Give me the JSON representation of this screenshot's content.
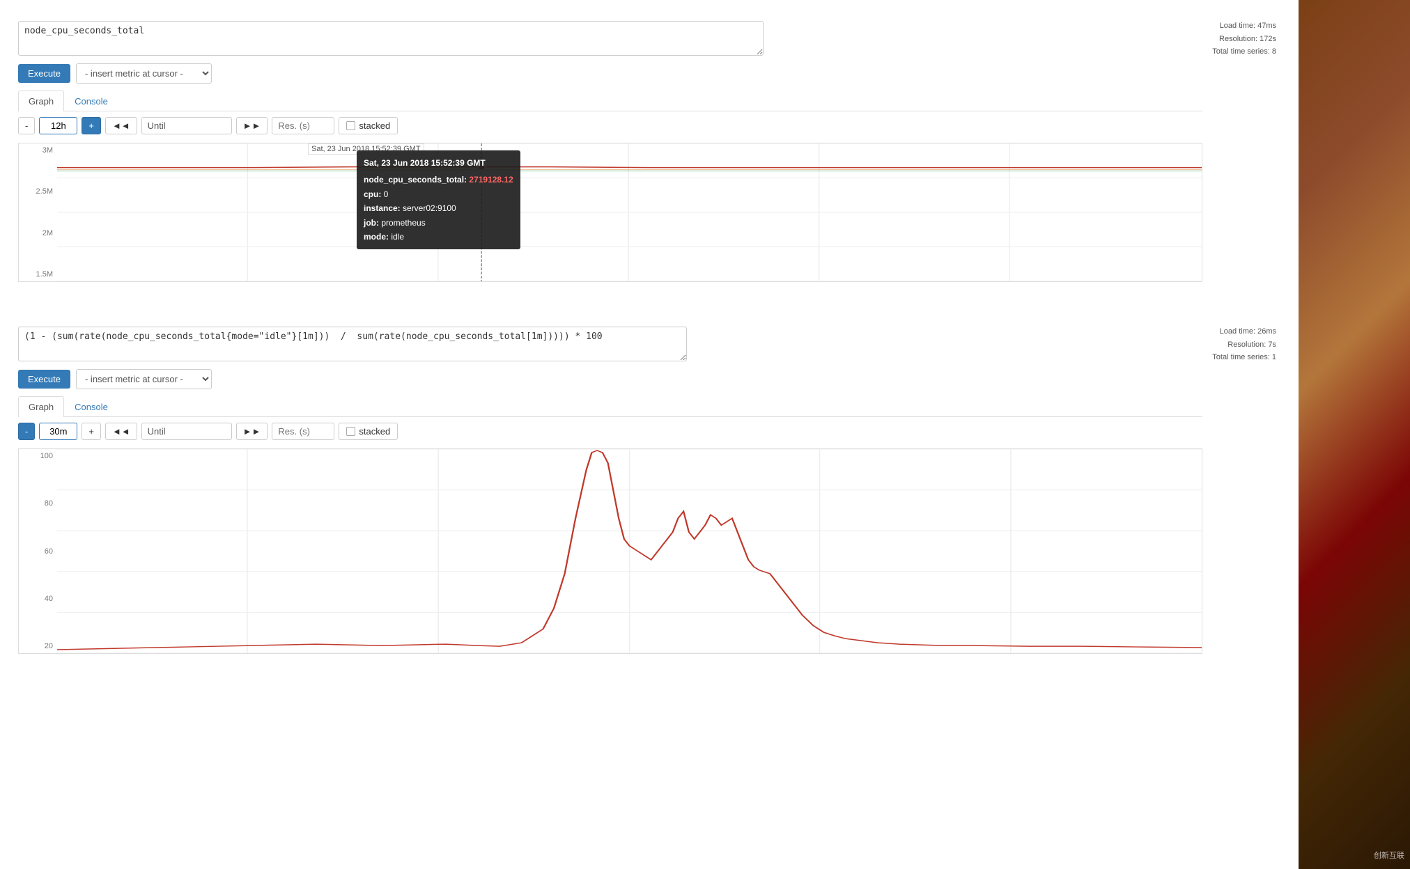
{
  "panel1": {
    "query": "node_cpu_seconds_total",
    "execute_label": "Execute",
    "insert_metric_placeholder": "- insert metric at cursor -",
    "meta": {
      "load_time": "Load time: 47ms",
      "resolution": "Resolution: 172s",
      "total_series": "Total time series: 8"
    },
    "tabs": [
      {
        "label": "Graph",
        "active": true
      },
      {
        "label": "Console",
        "active": false
      }
    ],
    "graph_controls": {
      "minus": "-",
      "time_range": "12h",
      "plus": "+",
      "back": "◄◄",
      "until": "Until",
      "forward": "►►",
      "res_placeholder": "Res. (s)",
      "stacked": "stacked"
    },
    "y_axis": [
      "3M",
      "2.5M",
      "2M",
      "1.5M"
    ],
    "tooltip": {
      "time": "Sat, 23 Jun 2018 15:52:39 GMT",
      "metric": "node_cpu_seconds_total:",
      "value": "2719128.12",
      "cpu": "0",
      "instance": "server02:9100",
      "job": "prometheus",
      "mode": "idle"
    }
  },
  "panel2": {
    "query": "(1 - (sum(rate(node_cpu_seconds_total{mode=\"idle\"}[1m]))  /  sum(rate(node_cpu_seconds_total[1m])))) * 100",
    "execute_label": "Execute",
    "insert_metric_placeholder": "- insert metric at cursor -",
    "meta": {
      "load_time": "Load time: 26ms",
      "resolution": "Resolution: 7s",
      "total_series": "Total time series: 1"
    },
    "tabs": [
      {
        "label": "Graph",
        "active": true
      },
      {
        "label": "Console",
        "active": false
      }
    ],
    "graph_controls": {
      "minus": "-",
      "time_range": "30m",
      "plus": "+",
      "back": "◄◄",
      "until": "Until",
      "forward": "►►",
      "res_placeholder": "Res. (s)",
      "stacked": "stacked"
    },
    "y_axis": [
      "100",
      "80",
      "60",
      "40",
      "20"
    ]
  },
  "watermark": "创新互联"
}
